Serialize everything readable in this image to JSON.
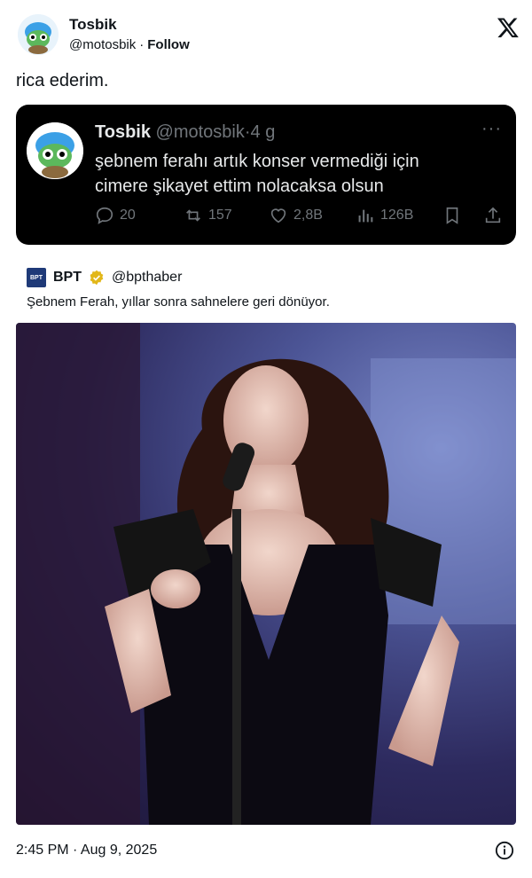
{
  "header": {
    "name": "Tosbik",
    "handle": "@motosbik",
    "separator": "·",
    "follow_label": "Follow",
    "avatar_icon": "turtle-avatar-icon",
    "logo_icon": "x-logo-icon"
  },
  "tweet": {
    "text": "rica ederim."
  },
  "embedded_tweet": {
    "name": "Tosbik",
    "handle": "@motosbik",
    "separator": "·",
    "age": "4 g",
    "more_label": "···",
    "line1": "şebnem ferahı artık konser vermediği için",
    "line2": "cimere şikayet ettim nolacaksa olsun",
    "actions": {
      "replies": "20",
      "retweets": "157",
      "likes": "2,8B",
      "views": "126B"
    },
    "colors": {
      "background": "#000000",
      "text": "#e7e9ea",
      "muted": "#71767b"
    }
  },
  "quoted": {
    "name": "BPT",
    "handle": "@bpthaber",
    "logo_text": "BPT",
    "text": "Şebnem Ferah, yıllar sonra sahnelere geri dönüyor.",
    "verified_color": "#e2b719"
  },
  "footer": {
    "timestamp": "2:45 PM · Aug 9, 2025"
  }
}
